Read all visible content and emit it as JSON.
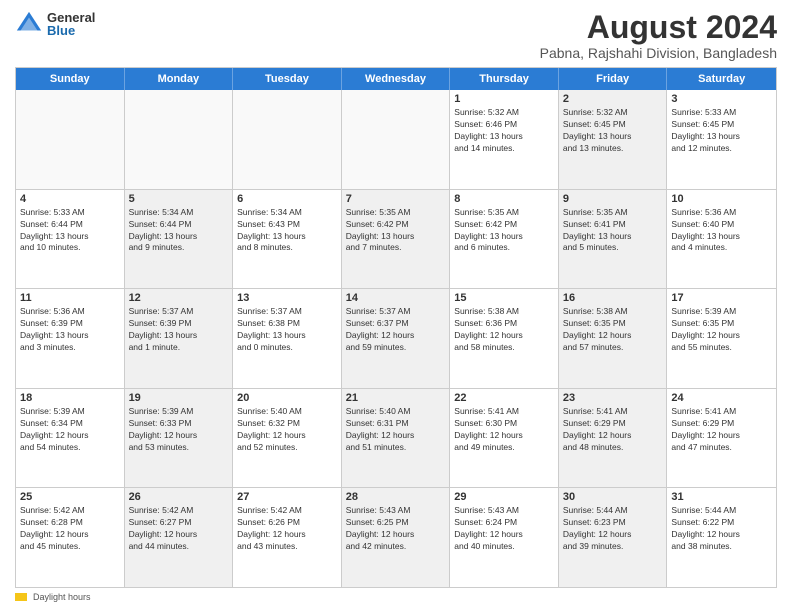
{
  "logo": {
    "general": "General",
    "blue": "Blue"
  },
  "title": "August 2024",
  "subtitle": "Pabna, Rajshahi Division, Bangladesh",
  "days_of_week": [
    "Sunday",
    "Monday",
    "Tuesday",
    "Wednesday",
    "Thursday",
    "Friday",
    "Saturday"
  ],
  "footer": {
    "daylight_label": "Daylight hours"
  },
  "weeks": [
    [
      {
        "day": "",
        "info": "",
        "empty": true
      },
      {
        "day": "",
        "info": "",
        "empty": true
      },
      {
        "day": "",
        "info": "",
        "empty": true
      },
      {
        "day": "",
        "info": "",
        "empty": true
      },
      {
        "day": "1",
        "info": "Sunrise: 5:32 AM\nSunset: 6:46 PM\nDaylight: 13 hours\nand 14 minutes.",
        "empty": false
      },
      {
        "day": "2",
        "info": "Sunrise: 5:32 AM\nSunset: 6:45 PM\nDaylight: 13 hours\nand 13 minutes.",
        "empty": false,
        "shaded": true
      },
      {
        "day": "3",
        "info": "Sunrise: 5:33 AM\nSunset: 6:45 PM\nDaylight: 13 hours\nand 12 minutes.",
        "empty": false
      }
    ],
    [
      {
        "day": "4",
        "info": "Sunrise: 5:33 AM\nSunset: 6:44 PM\nDaylight: 13 hours\nand 10 minutes.",
        "empty": false
      },
      {
        "day": "5",
        "info": "Sunrise: 5:34 AM\nSunset: 6:44 PM\nDaylight: 13 hours\nand 9 minutes.",
        "empty": false,
        "shaded": true
      },
      {
        "day": "6",
        "info": "Sunrise: 5:34 AM\nSunset: 6:43 PM\nDaylight: 13 hours\nand 8 minutes.",
        "empty": false
      },
      {
        "day": "7",
        "info": "Sunrise: 5:35 AM\nSunset: 6:42 PM\nDaylight: 13 hours\nand 7 minutes.",
        "empty": false,
        "shaded": true
      },
      {
        "day": "8",
        "info": "Sunrise: 5:35 AM\nSunset: 6:42 PM\nDaylight: 13 hours\nand 6 minutes.",
        "empty": false
      },
      {
        "day": "9",
        "info": "Sunrise: 5:35 AM\nSunset: 6:41 PM\nDaylight: 13 hours\nand 5 minutes.",
        "empty": false,
        "shaded": true
      },
      {
        "day": "10",
        "info": "Sunrise: 5:36 AM\nSunset: 6:40 PM\nDaylight: 13 hours\nand 4 minutes.",
        "empty": false
      }
    ],
    [
      {
        "day": "11",
        "info": "Sunrise: 5:36 AM\nSunset: 6:39 PM\nDaylight: 13 hours\nand 3 minutes.",
        "empty": false
      },
      {
        "day": "12",
        "info": "Sunrise: 5:37 AM\nSunset: 6:39 PM\nDaylight: 13 hours\nand 1 minute.",
        "empty": false,
        "shaded": true
      },
      {
        "day": "13",
        "info": "Sunrise: 5:37 AM\nSunset: 6:38 PM\nDaylight: 13 hours\nand 0 minutes.",
        "empty": false
      },
      {
        "day": "14",
        "info": "Sunrise: 5:37 AM\nSunset: 6:37 PM\nDaylight: 12 hours\nand 59 minutes.",
        "empty": false,
        "shaded": true
      },
      {
        "day": "15",
        "info": "Sunrise: 5:38 AM\nSunset: 6:36 PM\nDaylight: 12 hours\nand 58 minutes.",
        "empty": false
      },
      {
        "day": "16",
        "info": "Sunrise: 5:38 AM\nSunset: 6:35 PM\nDaylight: 12 hours\nand 57 minutes.",
        "empty": false,
        "shaded": true
      },
      {
        "day": "17",
        "info": "Sunrise: 5:39 AM\nSunset: 6:35 PM\nDaylight: 12 hours\nand 55 minutes.",
        "empty": false
      }
    ],
    [
      {
        "day": "18",
        "info": "Sunrise: 5:39 AM\nSunset: 6:34 PM\nDaylight: 12 hours\nand 54 minutes.",
        "empty": false
      },
      {
        "day": "19",
        "info": "Sunrise: 5:39 AM\nSunset: 6:33 PM\nDaylight: 12 hours\nand 53 minutes.",
        "empty": false,
        "shaded": true
      },
      {
        "day": "20",
        "info": "Sunrise: 5:40 AM\nSunset: 6:32 PM\nDaylight: 12 hours\nand 52 minutes.",
        "empty": false
      },
      {
        "day": "21",
        "info": "Sunrise: 5:40 AM\nSunset: 6:31 PM\nDaylight: 12 hours\nand 51 minutes.",
        "empty": false,
        "shaded": true
      },
      {
        "day": "22",
        "info": "Sunrise: 5:41 AM\nSunset: 6:30 PM\nDaylight: 12 hours\nand 49 minutes.",
        "empty": false
      },
      {
        "day": "23",
        "info": "Sunrise: 5:41 AM\nSunset: 6:29 PM\nDaylight: 12 hours\nand 48 minutes.",
        "empty": false,
        "shaded": true
      },
      {
        "day": "24",
        "info": "Sunrise: 5:41 AM\nSunset: 6:29 PM\nDaylight: 12 hours\nand 47 minutes.",
        "empty": false
      }
    ],
    [
      {
        "day": "25",
        "info": "Sunrise: 5:42 AM\nSunset: 6:28 PM\nDaylight: 12 hours\nand 45 minutes.",
        "empty": false
      },
      {
        "day": "26",
        "info": "Sunrise: 5:42 AM\nSunset: 6:27 PM\nDaylight: 12 hours\nand 44 minutes.",
        "empty": false,
        "shaded": true
      },
      {
        "day": "27",
        "info": "Sunrise: 5:42 AM\nSunset: 6:26 PM\nDaylight: 12 hours\nand 43 minutes.",
        "empty": false
      },
      {
        "day": "28",
        "info": "Sunrise: 5:43 AM\nSunset: 6:25 PM\nDaylight: 12 hours\nand 42 minutes.",
        "empty": false,
        "shaded": true
      },
      {
        "day": "29",
        "info": "Sunrise: 5:43 AM\nSunset: 6:24 PM\nDaylight: 12 hours\nand 40 minutes.",
        "empty": false
      },
      {
        "day": "30",
        "info": "Sunrise: 5:44 AM\nSunset: 6:23 PM\nDaylight: 12 hours\nand 39 minutes.",
        "empty": false,
        "shaded": true
      },
      {
        "day": "31",
        "info": "Sunrise: 5:44 AM\nSunset: 6:22 PM\nDaylight: 12 hours\nand 38 minutes.",
        "empty": false
      }
    ]
  ]
}
